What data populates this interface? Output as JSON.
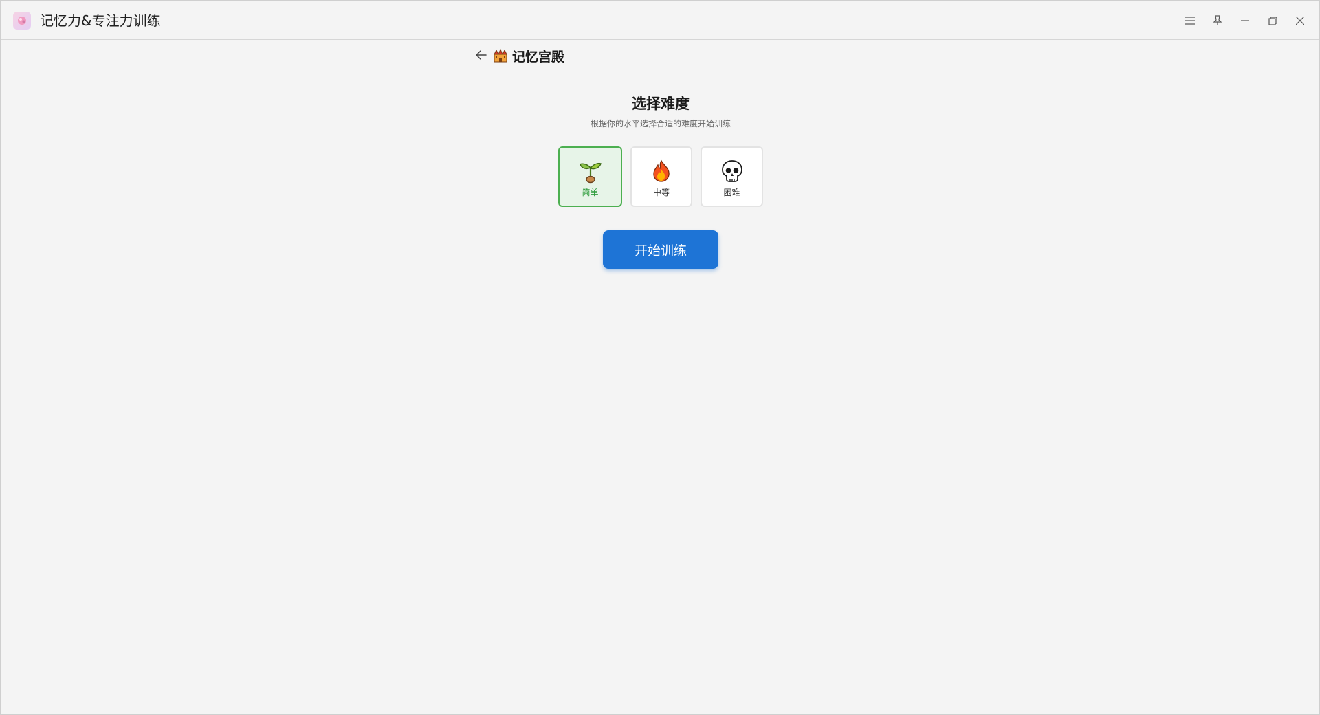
{
  "window": {
    "title": "记忆力&专注力训练",
    "controls": [
      "menu-icon",
      "pin-icon",
      "minimize-icon",
      "maximize-icon",
      "close-icon"
    ]
  },
  "header": {
    "back_icon": "arrow-left-icon",
    "page_icon": "castle-icon",
    "page_title": "记忆宫殿"
  },
  "difficulty": {
    "title": "选择难度",
    "subtitle": "根据你的水平选择合适的难度开始训练",
    "options": [
      {
        "label": "简单",
        "icon": "seedling-icon",
        "selected": true
      },
      {
        "label": "中等",
        "icon": "fire-icon",
        "selected": false
      },
      {
        "label": "困难",
        "icon": "skull-icon",
        "selected": false
      }
    ],
    "selected_color": "#4caf50"
  },
  "actions": {
    "start_label": "开始训练",
    "start_color": "#1e74d6"
  }
}
